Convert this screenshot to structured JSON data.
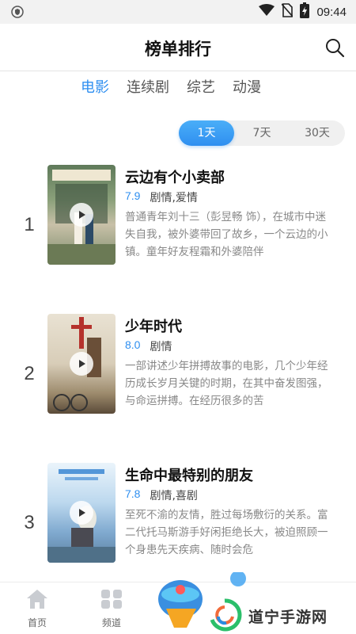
{
  "status_bar": {
    "time": "09:44"
  },
  "header": {
    "title": "榜单排行"
  },
  "category_tabs": [
    {
      "label": "电影",
      "active": true
    },
    {
      "label": "连续剧",
      "active": false
    },
    {
      "label": "综艺",
      "active": false
    },
    {
      "label": "动漫",
      "active": false
    }
  ],
  "range_options": [
    {
      "label": "1天",
      "active": true
    },
    {
      "label": "7天",
      "active": false
    },
    {
      "label": "30天",
      "active": false
    }
  ],
  "rank_items": [
    {
      "rank": "1",
      "title": "云边有个小卖部",
      "score": "7.9",
      "genre": "剧情,爱情",
      "desc": "普通青年刘十三（彭昱畅 饰），在城市中迷失自我，被外婆带回了故乡，一个云边的小镇。童年好友程霜和外婆陪伴"
    },
    {
      "rank": "2",
      "title": "少年时代",
      "score": "8.0",
      "genre": "剧情",
      "desc": "一部讲述少年拼搏故事的电影，几个少年经历成长岁月关键的时期，在其中奋发图强，与命运拼搏。在经历很多的苦"
    },
    {
      "rank": "3",
      "title": "生命中最特别的朋友",
      "score": "7.8",
      "genre": "剧情,喜剧",
      "desc": "至死不渝的友情，胜过每场敷衍的关系。富二代托马斯游手好闲拒绝长大，被迫照顾一个身患先天疾病、随时会危"
    }
  ],
  "bottom_nav": [
    {
      "label": "首页",
      "icon": "home-icon"
    },
    {
      "label": "频道",
      "icon": "grid-icon"
    }
  ],
  "watermark": {
    "text": "道宁手游网"
  },
  "colors": {
    "accent": "#2f8ff0"
  }
}
